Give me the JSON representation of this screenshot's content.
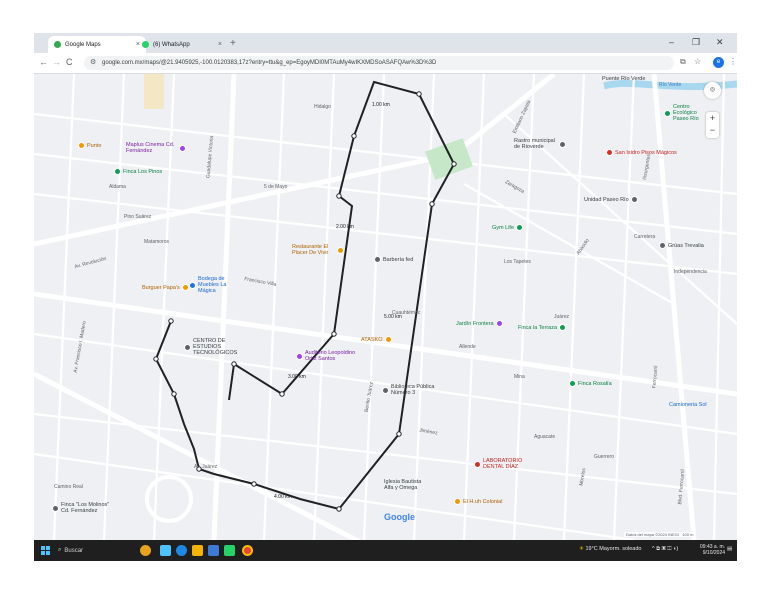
{
  "browser": {
    "tabs": [
      {
        "label": "Google Maps",
        "close": "×"
      },
      {
        "label": "(6) WhatsApp",
        "close": "×"
      }
    ],
    "new_tab": "+",
    "window_controls": {
      "minimize": "–",
      "maximize": "❐",
      "close": "✕"
    },
    "nav": {
      "back": "←",
      "forward": "→",
      "reload": "C"
    },
    "url": "google.com.mx/maps/@21.9405925,-100.0120383,17z?entry=ttu&g_ep=EgoyMDI0MTAuMy4wIKXMDSoASAFQAw%3D%3D",
    "profile_initial": "e",
    "icons": {
      "bookmark": "☆",
      "extensions": "⧉",
      "menu": "⋮",
      "security": "⚙"
    }
  },
  "map": {
    "street_labels": [
      "Av. Revolución",
      "Guadalupe Victoria",
      "Cuauhtémoc",
      "5 de Mayo",
      "Hidalgo",
      "Aldama",
      "Zaragoza",
      "Av. Francisco I. Madero",
      "Matamoros",
      "Pino Suárez",
      "Allende",
      "Juárez",
      "Abasolo",
      "Morelos",
      "Insurgentes",
      "Ferrocarril",
      "Blvd. Ferrocarril",
      "Francisco Villa",
      "Jiménez",
      "Los Tapetes",
      "Mina",
      "Av. Juárez",
      "Guerrero",
      "Río Verde",
      "Carretera",
      "Camino Real",
      "Aguacate",
      "Benito Juárez",
      "Independencia",
      "Emiliano Zapata"
    ],
    "pois": [
      {
        "name": "Punto",
        "color": "#f29900"
      },
      {
        "name": "Maplus Cinema Cd. Fernández",
        "color": "#a142f4"
      },
      {
        "name": "Finca Los Pinos",
        "color": "#0f9d58"
      },
      {
        "name": "Restaurante El Placer De Vivir",
        "color": "#f29900"
      },
      {
        "name": "Burguer Papa's",
        "color": "#f29900"
      },
      {
        "name": "Bodega de Muebles La Mágica",
        "color": "#1a73e8"
      },
      {
        "name": "CENTRO DE ESTUDIOS TECNOLÓGICOS",
        "color": "#5f6368"
      },
      {
        "name": "Auditorio Leopoldino Ortiz Santos",
        "color": "#a142f4"
      },
      {
        "name": "ATASKO",
        "color": "#f29900"
      },
      {
        "name": "Biblioteca Pública Número 3",
        "color": "#5f6368"
      },
      {
        "name": "Gym Life",
        "color": "#0f9d58"
      },
      {
        "name": "Jardín Frontera",
        "color": "#0f9d58"
      },
      {
        "name": "Finca la Terraza",
        "color": "#0f9d58"
      },
      {
        "name": "Finca Rosalía",
        "color": "#0f9d58"
      },
      {
        "name": "San Isidro Pisos Mágicos",
        "color": "#d93025"
      },
      {
        "name": "Centro Ecológico Paseo Río",
        "color": "#0f9d58"
      },
      {
        "name": "Unidad Paseo Río",
        "color": "#5f6368"
      },
      {
        "name": "Rastro municipal de Rioverde",
        "color": "#5f6368"
      },
      {
        "name": "Grúas Trevalia",
        "color": "#5f6368"
      },
      {
        "name": "LABORATORIO DENTAL DÍAZ",
        "color": "#d93025"
      },
      {
        "name": "Iglesia Bautista Alfa y Omega",
        "color": "#5f6368"
      },
      {
        "name": "El H.uh Colonial",
        "color": "#f29900"
      },
      {
        "name": "Camioneria Sol",
        "color": "#1a73e8"
      },
      {
        "name": "Finca \"Los Molinos\" Cd. Fernández",
        "color": "#5f6368"
      },
      {
        "name": "Puente Río Verde",
        "color": "#5f6368"
      },
      {
        "name": "Barbería fed",
        "color": "#5f6368"
      }
    ],
    "route_distance_labels": [
      "1.00 km",
      "2.00 km",
      "3.00 km",
      "4.00 km",
      "5.00 km"
    ],
    "google_logo": "Google",
    "attribution": "Datos del mapa ©2024 INEGI",
    "scale": "100 m",
    "zoom_in": "+",
    "zoom_out": "−",
    "compass": "◎"
  },
  "taskbar": {
    "search_placeholder": "Buscar",
    "weather": "19°C Mayorm. soleado",
    "time": "09:43 a. m.",
    "date": "9/10/2024",
    "start_icon": "windows-logo"
  }
}
